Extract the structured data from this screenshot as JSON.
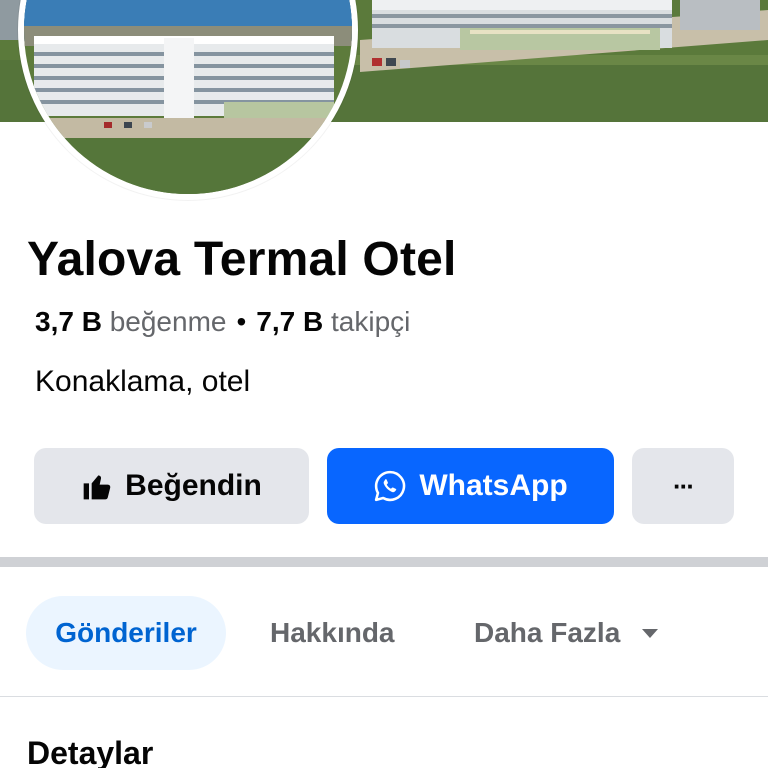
{
  "page": {
    "name": "Yalova Termal Otel",
    "likes_count": "3,7 B",
    "likes_label": "beğenme",
    "separator": "•",
    "followers_count": "7,7 B",
    "followers_label": "takipçi",
    "category": "Konaklama, otel"
  },
  "actions": {
    "like_label": "Beğendin",
    "whatsapp_label": "WhatsApp",
    "more_label": "···"
  },
  "tabs": [
    {
      "label": "Gönderiler",
      "active": true
    },
    {
      "label": "Hakkında",
      "active": false
    },
    {
      "label": "Daha Fazla",
      "active": false
    }
  ],
  "section": {
    "title": "Detaylar"
  },
  "icons": {
    "like": "thumbs-up-icon",
    "whatsapp": "whatsapp-icon",
    "dropdown": "caret-down-icon"
  },
  "colors": {
    "primary": "#0866ff",
    "secondary_button": "#e4e6eb",
    "active_tab_bg": "#ebf5ff",
    "active_tab_text": "#0064d1",
    "muted_text": "#65676b"
  }
}
